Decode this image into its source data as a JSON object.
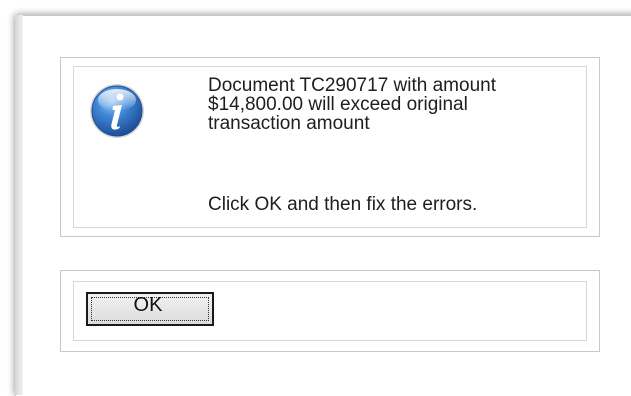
{
  "dialog": {
    "icon": "info-icon",
    "message_lines": [
      "Document TC290717 with amount",
      "$14,800.00 will exceed original",
      "transaction amount"
    ],
    "instruction": "Click OK and then fix the errors.",
    "ok_label": "OK"
  },
  "colors": {
    "icon_blue": "#2f6fb8",
    "text": "#1e1e1e",
    "border": "#c8c8c8"
  }
}
